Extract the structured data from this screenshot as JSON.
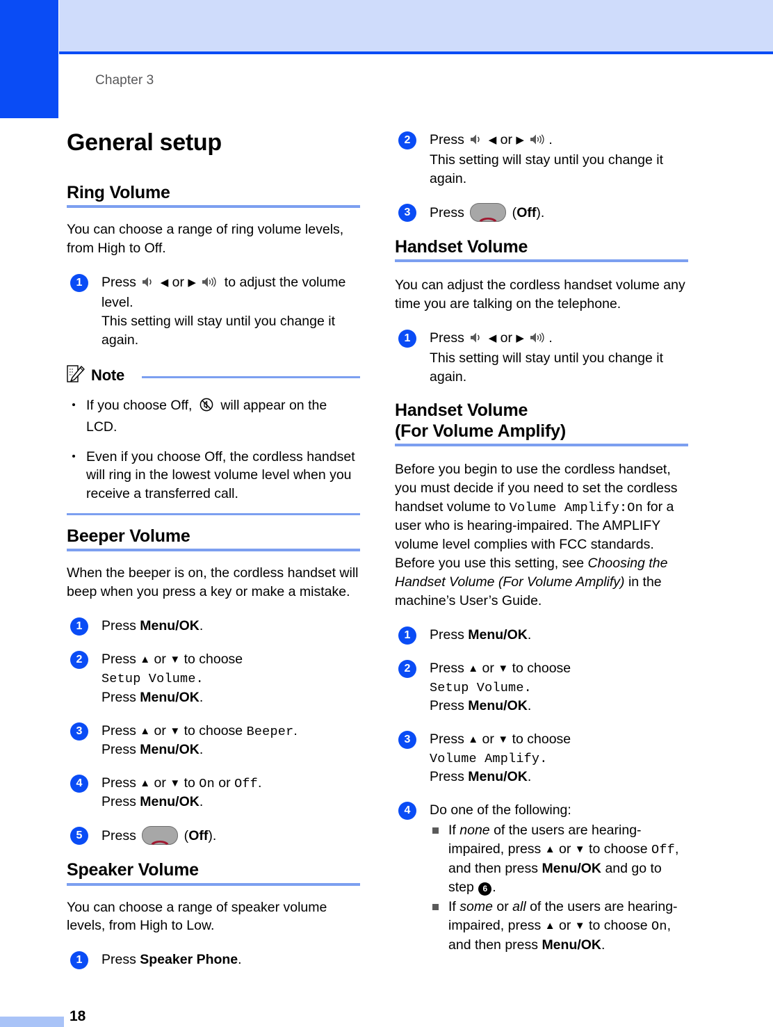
{
  "header": {
    "chapter_label": "Chapter 3"
  },
  "footer": {
    "page_number": "18"
  },
  "colors": {
    "brand_blue": "#0a4cf5",
    "header_band": "#cfdcfb",
    "rule_blue": "#7c9ff0",
    "footer_bar": "#a9c3f7",
    "step_badge": "#0a4cf5",
    "handset_red": "#a01830",
    "key_gray": "#a7a7a7"
  },
  "page_title": "General setup",
  "left_column": {
    "ring_volume": {
      "heading": "Ring Volume",
      "intro": "You can choose a range of ring volume levels, from High to Off.",
      "steps": [
        {
          "number": "1",
          "lines": [
            "Press {spk1} {left} or {right} {spk3} to adjust the volume level.",
            "This setting will stay until you change it again."
          ]
        }
      ],
      "note": {
        "label": "Note",
        "items": [
          "If you choose Off, {ringoff} will appear on the LCD.",
          "Even if you choose Off, the cordless handset will ring in the lowest volume level when you receive a transferred call."
        ]
      }
    },
    "beeper_volume": {
      "heading": "Beeper Volume",
      "intro": "When the beeper is on, the cordless handset will beep when you press a key or make a mistake.",
      "steps": [
        {
          "number": "1",
          "lines": [
            "Press {b}Menu/OK{/b}."
          ]
        },
        {
          "number": "2",
          "lines": [
            "Press {up} or {down} to choose",
            "{lcd}Setup Volume.{/lcd}",
            "Press {b}Menu/OK{/b}."
          ]
        },
        {
          "number": "3",
          "lines": [
            "Press {up} or {down} to choose {lcd}Beeper{/lcd}.",
            "Press {b}Menu/OK{/b}."
          ]
        },
        {
          "number": "4",
          "lines": [
            "Press {up} or {down} to {lcd}On{/lcd} or {lcd}Off{/lcd}.",
            "Press {b}Menu/OK{/b}."
          ]
        },
        {
          "number": "5",
          "lines": [
            "Press {offkey} ({b}Off{/b})."
          ]
        }
      ]
    },
    "speaker_volume": {
      "heading": "Speaker Volume",
      "intro": "You can choose a range of speaker volume levels, from High to Low.",
      "steps": [
        {
          "number": "1",
          "lines": [
            "Press {b}Speaker Phone{/b}."
          ]
        }
      ]
    }
  },
  "right_column": {
    "speaker_volume_continued": {
      "steps": [
        {
          "number": "2",
          "lines": [
            "Press {spk1} {left} or {right} {spk3}.",
            "This setting will stay until you change it again."
          ]
        },
        {
          "number": "3",
          "lines": [
            "Press {offkey} ({b}Off{/b})."
          ]
        }
      ]
    },
    "handset_volume": {
      "heading": "Handset Volume",
      "intro": "You can adjust the cordless handset volume any time you are talking on the telephone.",
      "steps": [
        {
          "number": "1",
          "lines": [
            "Press {spk1} {left} or {right} {spk3}.",
            "This setting will stay until you change it again."
          ]
        }
      ]
    },
    "handset_volume_amplify": {
      "heading_line1": "Handset Volume",
      "heading_line2": "(For Volume Amplify)",
      "intro": "Before you begin to use the cordless handset, you must decide if you need to set the cordless handset volume to {lcd}Volume Amplify:On{/lcd} for a user who is hearing-impaired. The AMPLIFY volume level complies with FCC standards. Before you use this setting, see {i}Choosing the Handset Volume (For Volume Amplify){/i} in the machine’s User’s Guide.",
      "steps": [
        {
          "number": "1",
          "lines": [
            "Press {b}Menu/OK{/b}."
          ]
        },
        {
          "number": "2",
          "lines": [
            "Press {up} or {down} to choose",
            "{lcd}Setup Volume.{/lcd}",
            "Press {b}Menu/OK{/b}."
          ]
        },
        {
          "number": "3",
          "lines": [
            "Press {up} or {down} to choose",
            "{lcd}Volume Amplify.{/lcd}",
            "Press {b}Menu/OK{/b}."
          ]
        },
        {
          "number": "4",
          "lines": [
            "Do one of the following:"
          ],
          "sub_items": [
            "If {i}none{/i} of the users are hearing-impaired, press {up} or {down} to choose {lcd}Off{/lcd}, and then press {b}Menu/OK{/b} and go to step {ref6}.",
            "If {i}some{/i} or {i}all{/i} of the users are hearing-impaired, press {up} or {down} to choose {lcd}On{/lcd}, and then press {b}Menu/OK{/b}."
          ]
        }
      ]
    }
  },
  "icons": {
    "speaker_low": "speaker-low-icon",
    "speaker_high": "speaker-high-icon",
    "left_arrow": "left-arrow-icon",
    "right_arrow": "right-arrow-icon",
    "up_arrow": "up-arrow-icon",
    "down_arrow": "down-arrow-icon",
    "ring_off": "ring-off-icon",
    "off_key": "off-key-icon",
    "note": "note-pencil-icon",
    "step_reference_6": "6"
  }
}
